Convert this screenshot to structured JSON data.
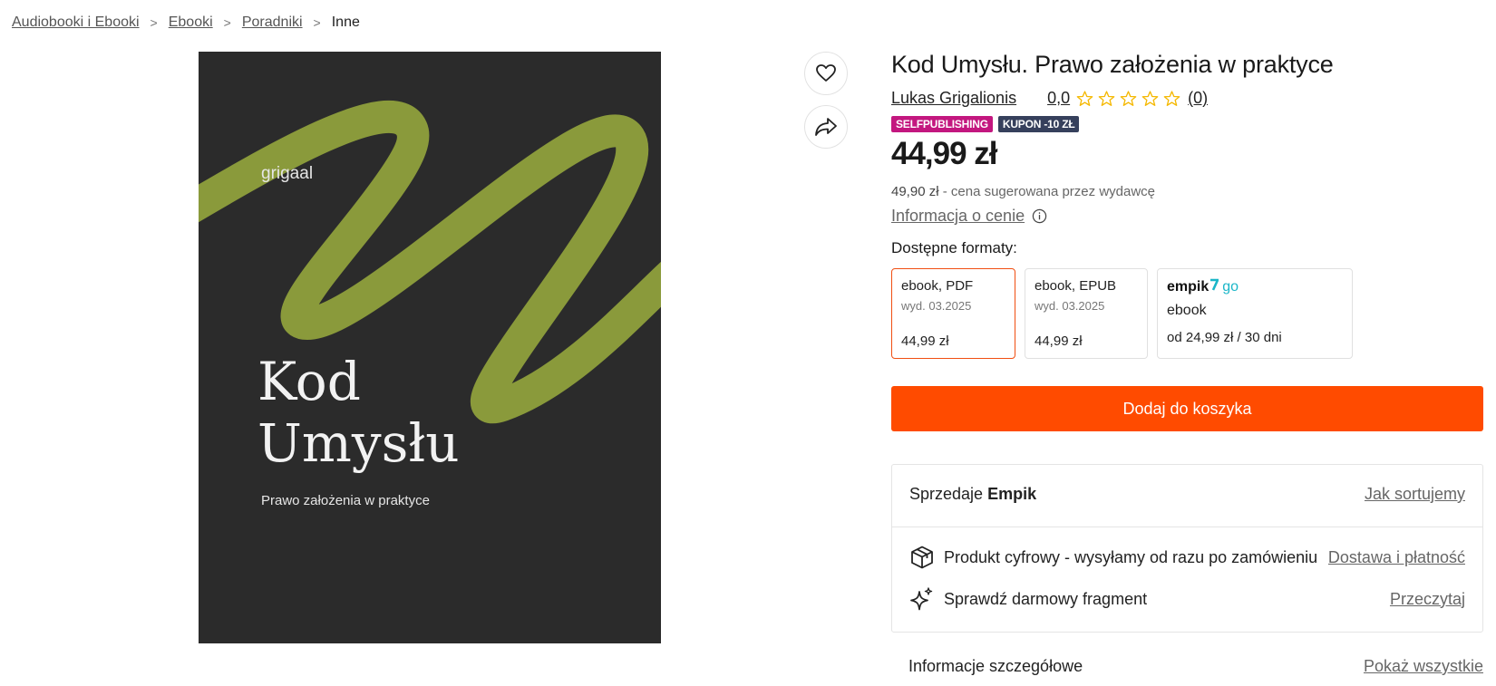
{
  "breadcrumb": {
    "items": [
      "Audiobooki i Ebooki",
      "Ebooki",
      "Poradniki"
    ],
    "current": "Inne",
    "separator": ">"
  },
  "cover": {
    "brand": "grigaal",
    "title_line1": "Kod",
    "title_line2": "Umysłu",
    "subtitle": "Prawo założenia w praktyce",
    "background": "#2b2b2b",
    "accent": "#8a9a3b"
  },
  "product": {
    "title": "Kod Umysłu. Prawo założenia w praktyce",
    "author": "Lukas Grigalionis",
    "rating": "0,0",
    "stars_filled": 0,
    "stars_total": 5,
    "rating_count": "(0)",
    "badges": [
      "SELFPUBLISHING",
      "KUPON -10 ZŁ"
    ],
    "price": "44,99 zł",
    "old_price": "49,90 zł",
    "old_price_label": "- cena sugerowana przez wydawcę",
    "price_info_link": "Informacja o cenie",
    "formats_label": "Dostępne formaty:"
  },
  "formats": [
    {
      "name": "ebook, PDF",
      "date": "wyd. 03.2025",
      "price": "44,99 zł"
    },
    {
      "name": "ebook, EPUB",
      "date": "wyd. 03.2025",
      "price": "44,99 zł"
    }
  ],
  "empik_go": {
    "logo": "empik",
    "logo_go": "go",
    "type": "ebook",
    "price": "od 24,99 zł / 30 dni"
  },
  "add_to_cart": "Dodaj do koszyka",
  "seller": {
    "label": "Sprzedaje",
    "name": "Empik",
    "link": "Jak sortujemy"
  },
  "delivery": {
    "text": "Produkt cyfrowy - wysyłamy od razu po zamówieniu",
    "link": "Dostawa i płatność"
  },
  "sample": {
    "text": "Sprawdź darmowy fragment",
    "link": "Przeczytaj"
  },
  "details": {
    "label": "Informacje szczegółowe",
    "link": "Pokaż wszystkie"
  },
  "colors": {
    "accent": "#ff4b00",
    "selfpublishing_badge": "#c3177f",
    "kupon_badge": "#36405c",
    "star": "#f5b800"
  }
}
